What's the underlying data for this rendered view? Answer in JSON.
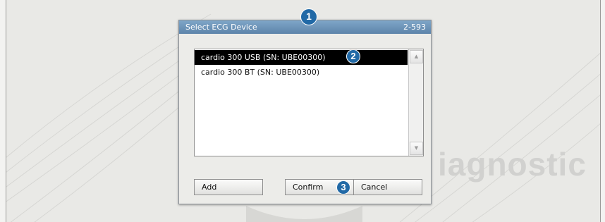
{
  "dialog": {
    "title": "Select ECG Device",
    "code": "2-593",
    "devices": [
      {
        "label": "cardio 300 USB (SN: UBE00300)",
        "selected": true
      },
      {
        "label": "cardio 300 BT (SN: UBE00300)",
        "selected": false
      }
    ],
    "buttons": {
      "add": "Add",
      "confirm": "Confirm",
      "cancel": "Cancel"
    }
  },
  "background": {
    "brand_text": "iagnostic"
  },
  "markers": [
    "1",
    "2",
    "3"
  ],
  "icons": {
    "scroll_up": "triangle-up",
    "scroll_down": "triangle-down"
  },
  "colors": {
    "titlebar": "#6c93b8",
    "selection": "#000000",
    "marker": "#2169a6"
  }
}
